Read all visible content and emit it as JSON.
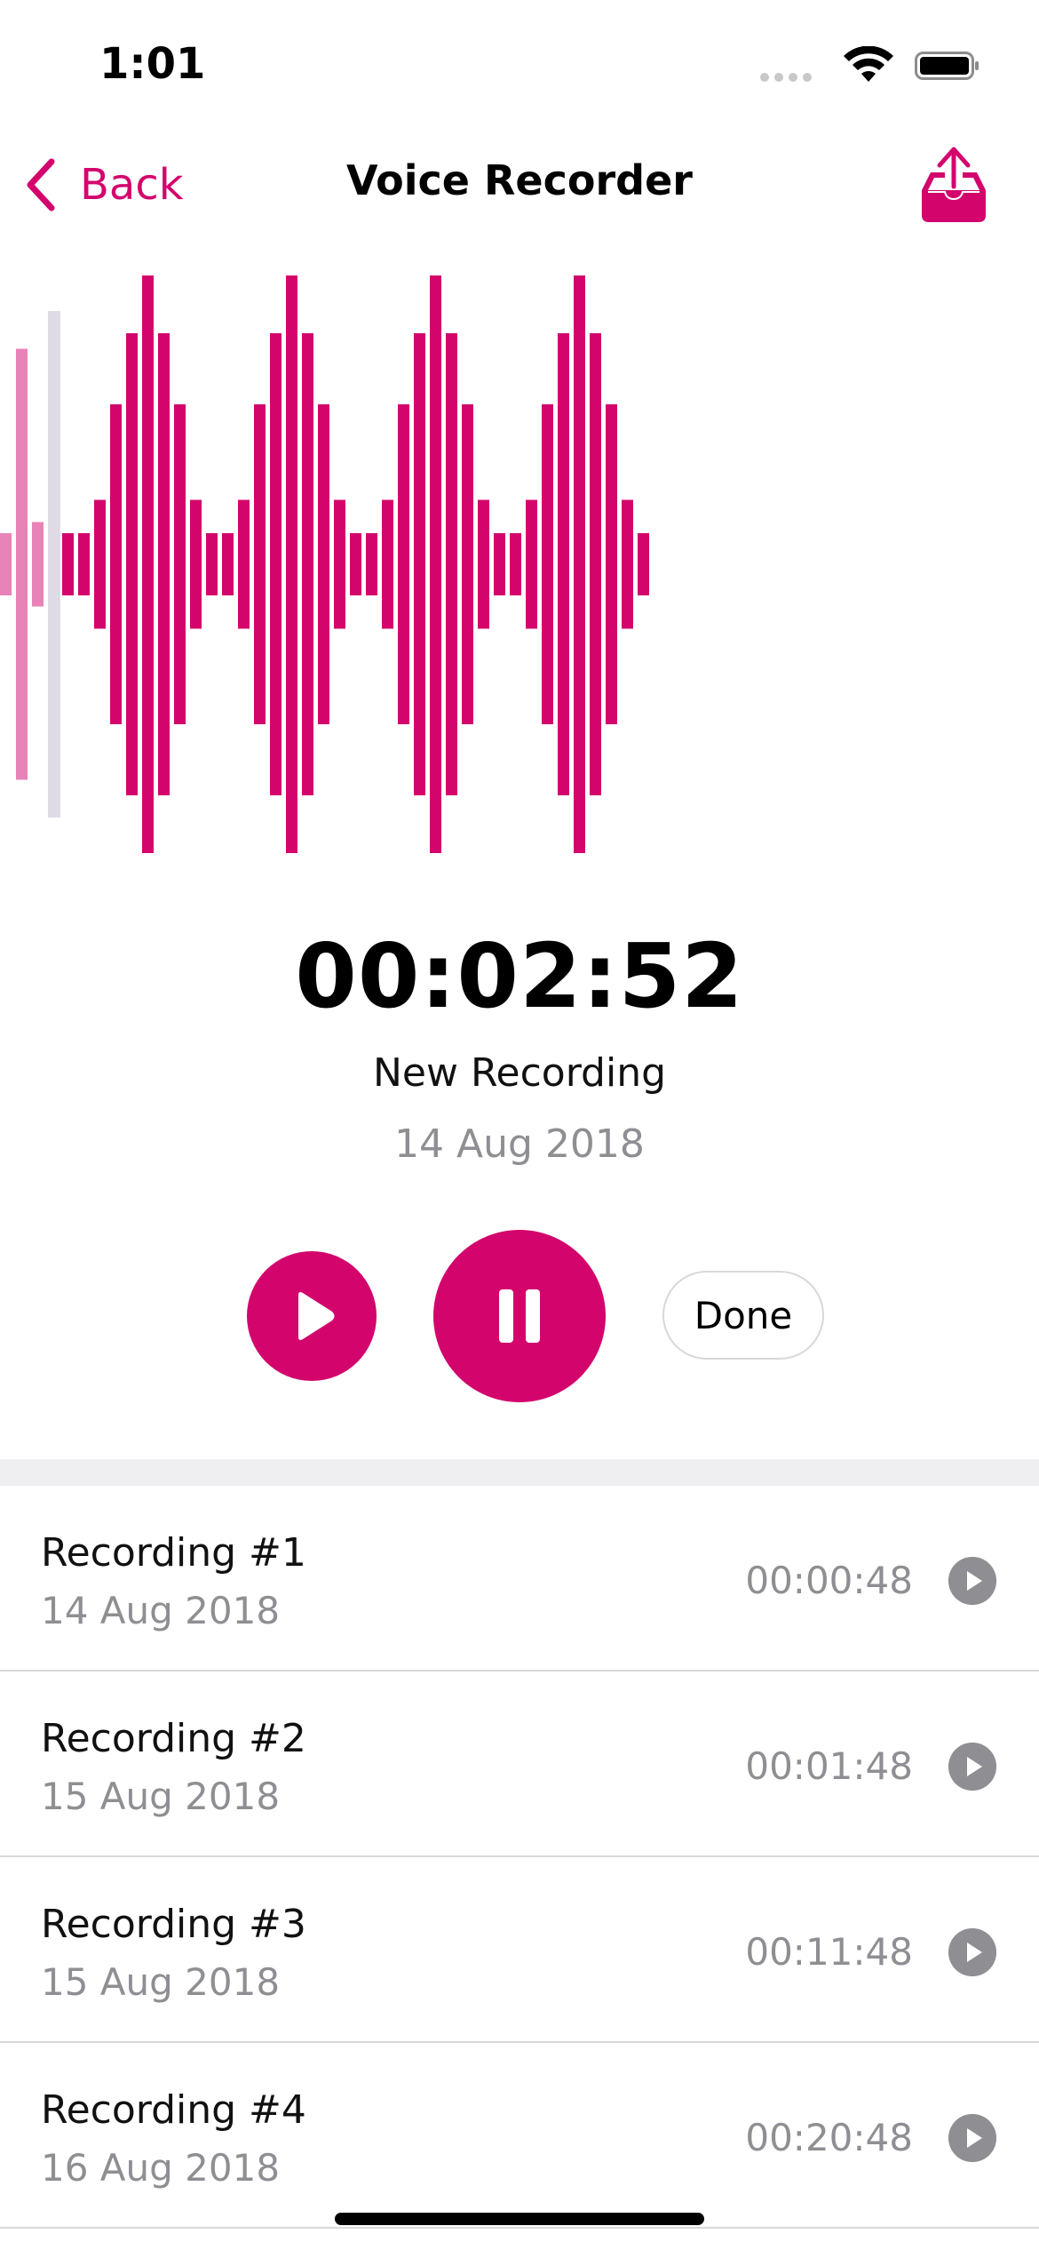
{
  "status_bar": {
    "time": "1:01"
  },
  "nav": {
    "back_label": "Back",
    "title": "Voice Recorder"
  },
  "colors": {
    "accent": "#d3056d",
    "secondary_text": "#8e8e93",
    "divider": "#efeff1"
  },
  "icons": {
    "back": "chevron-left-icon",
    "share": "share-tray-icon",
    "play": "play-icon",
    "pause": "pause-icon"
  },
  "player": {
    "timer": "00:02:52",
    "name": "New Recording",
    "date": "14 Aug 2018",
    "done_label": "Done"
  },
  "recordings": [
    {
      "title": "Recording #1",
      "date": "14 Aug 2018",
      "duration": "00:00:48"
    },
    {
      "title": "Recording #2",
      "date": "15 Aug 2018",
      "duration": "00:01:48"
    },
    {
      "title": "Recording #3",
      "date": "15 Aug 2018",
      "duration": "00:11:48"
    },
    {
      "title": "Recording #4",
      "date": "16 Aug 2018",
      "duration": "00:20:48"
    }
  ]
}
